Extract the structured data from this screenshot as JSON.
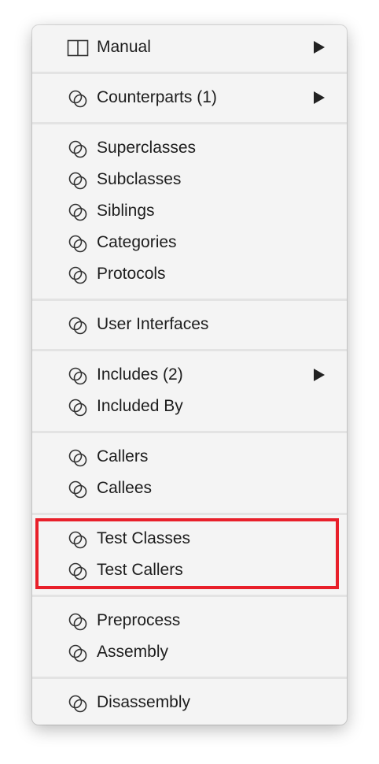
{
  "menu": {
    "items": [
      {
        "label": "Manual",
        "icon": "book-icon",
        "submenu": true
      },
      {
        "label": "Counterparts (1)",
        "icon": "related-items-icon",
        "submenu": true
      },
      {
        "label": "Superclasses",
        "icon": "related-items-icon"
      },
      {
        "label": "Subclasses",
        "icon": "related-items-icon"
      },
      {
        "label": "Siblings",
        "icon": "related-items-icon"
      },
      {
        "label": "Categories",
        "icon": "related-items-icon"
      },
      {
        "label": "Protocols",
        "icon": "related-items-icon"
      },
      {
        "label": "User Interfaces",
        "icon": "related-items-icon"
      },
      {
        "label": "Includes (2)",
        "icon": "related-items-icon",
        "submenu": true
      },
      {
        "label": "Included By",
        "icon": "related-items-icon"
      },
      {
        "label": "Callers",
        "icon": "related-items-icon"
      },
      {
        "label": "Callees",
        "icon": "related-items-icon"
      },
      {
        "label": "Test Classes",
        "icon": "related-items-icon"
      },
      {
        "label": "Test Callers",
        "icon": "related-items-icon"
      },
      {
        "label": "Preprocess",
        "icon": "related-items-icon"
      },
      {
        "label": "Assembly",
        "icon": "related-items-icon"
      },
      {
        "label": "Disassembly",
        "icon": "related-items-icon"
      }
    ]
  },
  "annotation": {
    "color": "#e81f2a"
  }
}
